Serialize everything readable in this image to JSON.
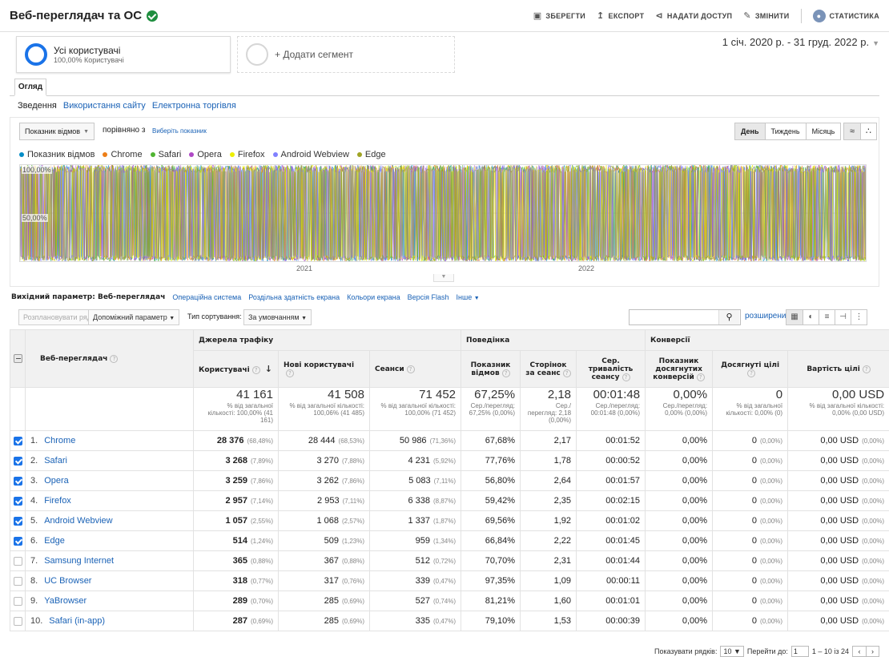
{
  "header": {
    "title": "Веб-переглядач та ОС",
    "actions": {
      "save": "ЗБЕРЕГТИ",
      "export": "ЕКСПОРТ",
      "share": "НАДАТИ ДОСТУП",
      "edit": "ЗМІНИТИ",
      "insights": "СТАТИСТИКА"
    }
  },
  "segments": {
    "active_name": "Усі користувачі",
    "active_sub": "100,00% Користувачі",
    "add_label": "+ Додати сегмент"
  },
  "date_range": "1 січ. 2020 р. - 31 груд. 2022 р.",
  "tabs": {
    "overview": "Огляд"
  },
  "subnav": [
    "Зведення",
    "Використання сайту",
    "Електронна торгівля"
  ],
  "chart_controls": {
    "metric": "Показник відмов",
    "compare_text": "порівняно з",
    "compare_link": "Виберіть показник",
    "periods": [
      "День",
      "Тиждень",
      "Місяць"
    ]
  },
  "chart_data": {
    "type": "area",
    "legend": [
      {
        "name": "Показник відмов",
        "color": "#058dc7"
      },
      {
        "name": "Chrome",
        "color": "#ed7e17"
      },
      {
        "name": "Safari",
        "color": "#50b432"
      },
      {
        "name": "Opera",
        "color": "#af49c5"
      },
      {
        "name": "Firefox",
        "color": "#edef00"
      },
      {
        "name": "Android Webview",
        "color": "#8080ff"
      },
      {
        "name": "Edge",
        "color": "#a0a424"
      }
    ],
    "y_labels": [
      "100,00%",
      "50,00%"
    ],
    "x_labels": [
      "2021",
      "2022"
    ],
    "ylim": [
      0,
      100
    ]
  },
  "dimensions": {
    "label": "Вихідний параметр:",
    "current": "Веб-переглядач",
    "others": [
      "Операційна система",
      "Роздільна здатність екрана",
      "Кольори екрана",
      "Версія Flash",
      "Інше"
    ]
  },
  "toolbar": {
    "plot_rows": "Розплановувати ряди",
    "secondary": "Допоміжний параметр",
    "sort_label": "Тип сортування:",
    "sort_value": "За умовчанням",
    "advanced": "розширений"
  },
  "table": {
    "groups": {
      "acquisition": "Джерела трафіку",
      "behavior": "Поведінка",
      "conversions": "Конверсії"
    },
    "headers": {
      "browser": "Веб-переглядач",
      "users": "Користувачі",
      "new_users": "Нові користувачі",
      "sessions": "Сеанси",
      "bounce": "Показник відмов",
      "pages": "Сторінок за сеанс",
      "duration": "Сер. тривалість сеансу",
      "conv_rate": "Показник досягнутих конверсій",
      "goals": "Досягнуті цілі",
      "goal_value": "Вартість цілі"
    },
    "totals": {
      "users": "41 161",
      "users_sub": "% від загальної кількості: 100,00% (41 161)",
      "new_users": "41 508",
      "new_users_sub": "% від загальної кількості: 100,06% (41 485)",
      "sessions": "71 452",
      "sessions_sub": "% від загальної кількості: 100,00% (71 452)",
      "bounce": "67,25%",
      "bounce_sub": "Сер./перегляд: 67,25% (0,00%)",
      "pages": "2,18",
      "pages_sub": "Сер./ перегляд: 2,18 (0,00%)",
      "duration": "00:01:48",
      "duration_sub": "Сер./перегляд: 00:01:48 (0,00%)",
      "conv": "0,00%",
      "conv_sub": "Сер./перегляд: 0,00% (0,00%)",
      "goals": "0",
      "goals_sub": "% від загальної кількості: 0,00% (0)",
      "value": "0,00 USD",
      "value_sub": "% від загальної кількості: 0,00% (0,00 USD)"
    },
    "rows": [
      {
        "idx": "1.",
        "name": "Chrome",
        "checked": true,
        "users": "28 376",
        "users_pct": "(68,48%)",
        "new_users": "28 444",
        "new_users_pct": "(68,53%)",
        "sessions": "50 986",
        "sessions_pct": "(71,36%)",
        "bounce": "67,68%",
        "pages": "2,17",
        "duration": "00:01:52",
        "conv": "0,00%",
        "goals": "0",
        "goals_pct": "(0,00%)",
        "value": "0,00 USD",
        "value_pct": "(0,00%)"
      },
      {
        "idx": "2.",
        "name": "Safari",
        "checked": true,
        "users": "3 268",
        "users_pct": "(7,89%)",
        "new_users": "3 270",
        "new_users_pct": "(7,88%)",
        "sessions": "4 231",
        "sessions_pct": "(5,92%)",
        "bounce": "77,76%",
        "pages": "1,78",
        "duration": "00:00:52",
        "conv": "0,00%",
        "goals": "0",
        "goals_pct": "(0,00%)",
        "value": "0,00 USD",
        "value_pct": "(0,00%)"
      },
      {
        "idx": "3.",
        "name": "Opera",
        "checked": true,
        "users": "3 259",
        "users_pct": "(7,86%)",
        "new_users": "3 262",
        "new_users_pct": "(7,86%)",
        "sessions": "5 083",
        "sessions_pct": "(7,11%)",
        "bounce": "56,80%",
        "pages": "2,64",
        "duration": "00:01:57",
        "conv": "0,00%",
        "goals": "0",
        "goals_pct": "(0,00%)",
        "value": "0,00 USD",
        "value_pct": "(0,00%)"
      },
      {
        "idx": "4.",
        "name": "Firefox",
        "checked": true,
        "users": "2 957",
        "users_pct": "(7,14%)",
        "new_users": "2 953",
        "new_users_pct": "(7,11%)",
        "sessions": "6 338",
        "sessions_pct": "(8,87%)",
        "bounce": "59,42%",
        "pages": "2,35",
        "duration": "00:02:15",
        "conv": "0,00%",
        "goals": "0",
        "goals_pct": "(0,00%)",
        "value": "0,00 USD",
        "value_pct": "(0,00%)"
      },
      {
        "idx": "5.",
        "name": "Android Webview",
        "checked": true,
        "users": "1 057",
        "users_pct": "(2,55%)",
        "new_users": "1 068",
        "new_users_pct": "(2,57%)",
        "sessions": "1 337",
        "sessions_pct": "(1,87%)",
        "bounce": "69,56%",
        "pages": "1,92",
        "duration": "00:01:02",
        "conv": "0,00%",
        "goals": "0",
        "goals_pct": "(0,00%)",
        "value": "0,00 USD",
        "value_pct": "(0,00%)"
      },
      {
        "idx": "6.",
        "name": "Edge",
        "checked": true,
        "users": "514",
        "users_pct": "(1,24%)",
        "new_users": "509",
        "new_users_pct": "(1,23%)",
        "sessions": "959",
        "sessions_pct": "(1,34%)",
        "bounce": "66,84%",
        "pages": "2,22",
        "duration": "00:01:45",
        "conv": "0,00%",
        "goals": "0",
        "goals_pct": "(0,00%)",
        "value": "0,00 USD",
        "value_pct": "(0,00%)"
      },
      {
        "idx": "7.",
        "name": "Samsung Internet",
        "checked": false,
        "users": "365",
        "users_pct": "(0,88%)",
        "new_users": "367",
        "new_users_pct": "(0,88%)",
        "sessions": "512",
        "sessions_pct": "(0,72%)",
        "bounce": "70,70%",
        "pages": "2,31",
        "duration": "00:01:44",
        "conv": "0,00%",
        "goals": "0",
        "goals_pct": "(0,00%)",
        "value": "0,00 USD",
        "value_pct": "(0,00%)"
      },
      {
        "idx": "8.",
        "name": "UC Browser",
        "checked": false,
        "users": "318",
        "users_pct": "(0,77%)",
        "new_users": "317",
        "new_users_pct": "(0,76%)",
        "sessions": "339",
        "sessions_pct": "(0,47%)",
        "bounce": "97,35%",
        "pages": "1,09",
        "duration": "00:00:11",
        "conv": "0,00%",
        "goals": "0",
        "goals_pct": "(0,00%)",
        "value": "0,00 USD",
        "value_pct": "(0,00%)"
      },
      {
        "idx": "9.",
        "name": "YaBrowser",
        "checked": false,
        "users": "289",
        "users_pct": "(0,70%)",
        "new_users": "285",
        "new_users_pct": "(0,69%)",
        "sessions": "527",
        "sessions_pct": "(0,74%)",
        "bounce": "81,21%",
        "pages": "1,60",
        "duration": "00:01:01",
        "conv": "0,00%",
        "goals": "0",
        "goals_pct": "(0,00%)",
        "value": "0,00 USD",
        "value_pct": "(0,00%)"
      },
      {
        "idx": "10.",
        "name": "Safari (in-app)",
        "checked": false,
        "users": "287",
        "users_pct": "(0,69%)",
        "new_users": "285",
        "new_users_pct": "(0,69%)",
        "sessions": "335",
        "sessions_pct": "(0,47%)",
        "bounce": "79,10%",
        "pages": "1,53",
        "duration": "00:00:39",
        "conv": "0,00%",
        "goals": "0",
        "goals_pct": "(0,00%)",
        "value": "0,00 USD",
        "value_pct": "(0,00%)"
      }
    ]
  },
  "pagination": {
    "rows_label": "Показувати рядків:",
    "rows_value": "10",
    "goto_label": "Перейти до:",
    "goto_value": "1",
    "range": "1 – 10 із 24"
  }
}
